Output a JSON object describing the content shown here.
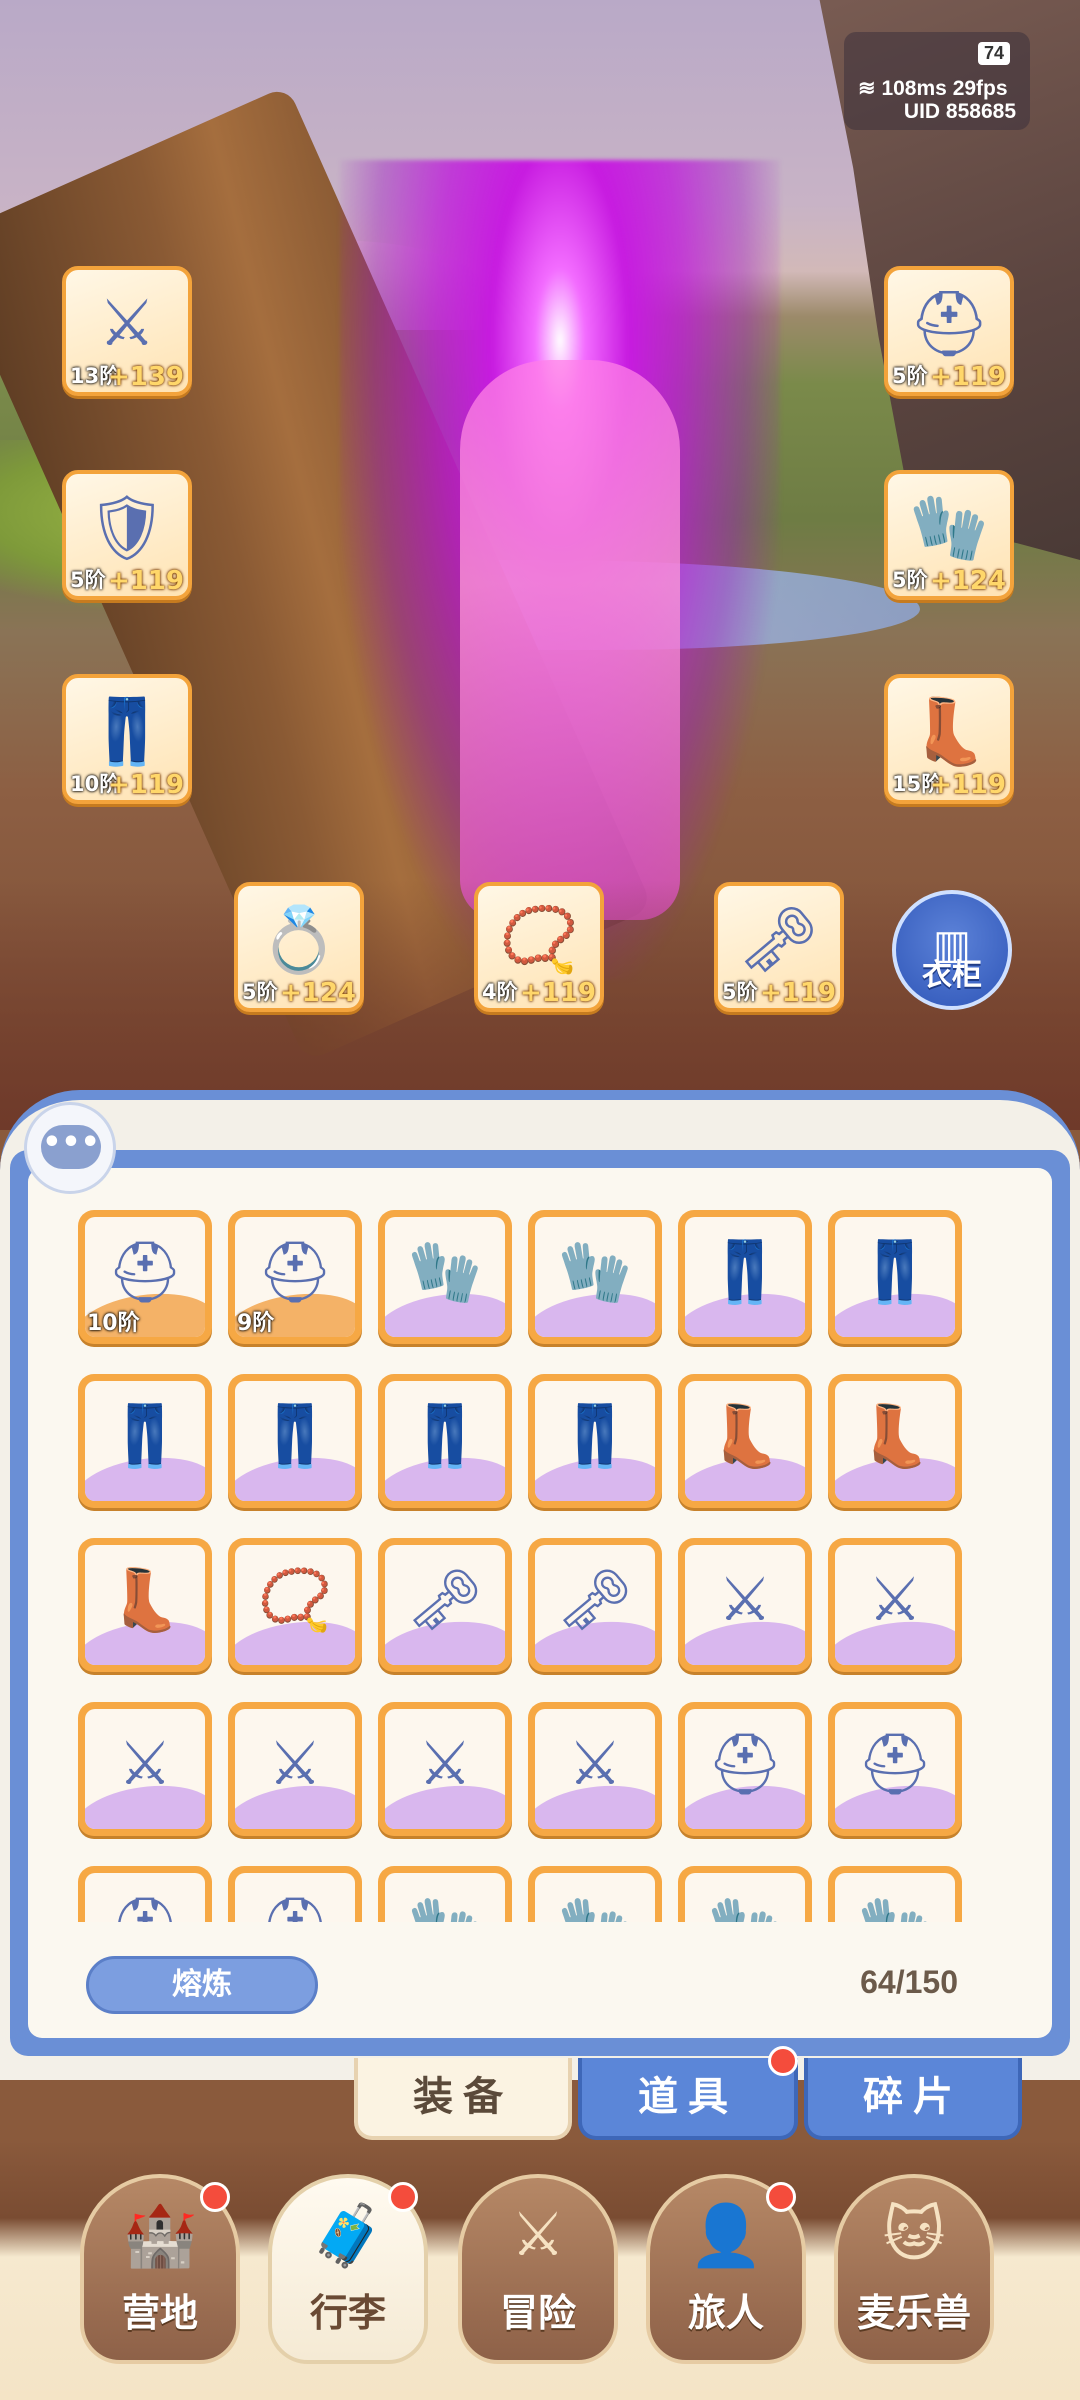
{
  "hud": {
    "battery": "74",
    "ping": "108ms",
    "fps": "29fps",
    "uid": "UID 858685"
  },
  "equipped": [
    {
      "name": "weapon",
      "icon": "⚔",
      "tier": "13阶",
      "bonus": "+139"
    },
    {
      "name": "chest",
      "icon": "🛡",
      "tier": "5阶",
      "bonus": "+119"
    },
    {
      "name": "legs",
      "icon": "👖",
      "tier": "10阶",
      "bonus": "+119"
    },
    {
      "name": "helmet",
      "icon": "⛑",
      "tier": "5阶",
      "bonus": "+119"
    },
    {
      "name": "gloves",
      "icon": "🧤",
      "tier": "5阶",
      "bonus": "+124"
    },
    {
      "name": "boots",
      "icon": "👢",
      "tier": "15阶",
      "bonus": "+119"
    },
    {
      "name": "ring",
      "icon": "💍",
      "tier": "5阶",
      "bonus": "+124"
    },
    {
      "name": "necklace",
      "icon": "📿",
      "tier": "4阶",
      "bonus": "+119"
    },
    {
      "name": "charm",
      "icon": "🗝",
      "tier": "5阶",
      "bonus": "+119"
    }
  ],
  "wardrobe_label": "衣柜",
  "chat_icon": "•••",
  "inventory": {
    "items": [
      {
        "type": "helmet",
        "icon": "⛑",
        "tier": "10阶",
        "bg": "orange"
      },
      {
        "type": "helmet",
        "icon": "⛑",
        "tier": "9阶",
        "bg": "orange"
      },
      {
        "type": "gloves",
        "icon": "🧤",
        "tier": "",
        "bg": "purple"
      },
      {
        "type": "gloves",
        "icon": "🧤",
        "tier": "",
        "bg": "purple"
      },
      {
        "type": "legs",
        "icon": "👖",
        "tier": "",
        "bg": "purple"
      },
      {
        "type": "legs",
        "icon": "👖",
        "tier": "",
        "bg": "purple"
      },
      {
        "type": "legs",
        "icon": "👖",
        "tier": "",
        "bg": "purple"
      },
      {
        "type": "legs",
        "icon": "👖",
        "tier": "",
        "bg": "purple"
      },
      {
        "type": "legs",
        "icon": "👖",
        "tier": "",
        "bg": "purple"
      },
      {
        "type": "legs",
        "icon": "👖",
        "tier": "",
        "bg": "purple"
      },
      {
        "type": "boots",
        "icon": "👢",
        "tier": "",
        "bg": "purple"
      },
      {
        "type": "boots",
        "icon": "👢",
        "tier": "",
        "bg": "purple"
      },
      {
        "type": "boots",
        "icon": "👢",
        "tier": "",
        "bg": "purple"
      },
      {
        "type": "necklace",
        "icon": "📿",
        "tier": "",
        "bg": "purple"
      },
      {
        "type": "charm",
        "icon": "🗝",
        "tier": "",
        "bg": "purple"
      },
      {
        "type": "charm",
        "icon": "🗝",
        "tier": "",
        "bg": "purple"
      },
      {
        "type": "weapon",
        "icon": "⚔",
        "tier": "",
        "bg": "purple"
      },
      {
        "type": "weapon",
        "icon": "⚔",
        "tier": "",
        "bg": "purple"
      },
      {
        "type": "weapon",
        "icon": "⚔",
        "tier": "",
        "bg": "purple"
      },
      {
        "type": "weapon",
        "icon": "⚔",
        "tier": "",
        "bg": "purple"
      },
      {
        "type": "weapon",
        "icon": "⚔",
        "tier": "",
        "bg": "purple"
      },
      {
        "type": "weapon",
        "icon": "⚔",
        "tier": "",
        "bg": "purple"
      },
      {
        "type": "helmet",
        "icon": "⛑",
        "tier": "",
        "bg": "purple"
      },
      {
        "type": "helmet",
        "icon": "⛑",
        "tier": "",
        "bg": "purple"
      },
      {
        "type": "helmet",
        "icon": "⛑",
        "tier": "",
        "bg": "purple"
      },
      {
        "type": "helmet",
        "icon": "⛑",
        "tier": "",
        "bg": "purple"
      },
      {
        "type": "gloves",
        "icon": "🧤",
        "tier": "",
        "bg": "purple"
      },
      {
        "type": "gloves",
        "icon": "🧤",
        "tier": "",
        "bg": "purple"
      },
      {
        "type": "gloves",
        "icon": "🧤",
        "tier": "",
        "bg": "purple"
      },
      {
        "type": "gloves",
        "icon": "🧤",
        "tier": "",
        "bg": "purple"
      }
    ],
    "smelt_label": "熔炼",
    "capacity": "64/150"
  },
  "tabs": {
    "equipment": "装备",
    "items": "道具",
    "shards": "碎片"
  },
  "nav": [
    {
      "name": "camp",
      "icon": "🏰",
      "label": "营地",
      "dot": true,
      "active": false
    },
    {
      "name": "luggage",
      "icon": "🧳",
      "label": "行李",
      "dot": true,
      "active": true
    },
    {
      "name": "adventure",
      "icon": "⚔",
      "label": "冒险",
      "dot": false,
      "active": false
    },
    {
      "name": "traveler",
      "icon": "👤",
      "label": "旅人",
      "dot": true,
      "active": false
    },
    {
      "name": "pet",
      "icon": "🐱",
      "label": "麦乐兽",
      "dot": false,
      "active": false
    }
  ],
  "colors": {
    "accent_blue": "#6a8fd6",
    "slot_orange": "#f3a33b",
    "badge_red": "#f44c3c",
    "bonus_gold": "#ffd76a"
  }
}
